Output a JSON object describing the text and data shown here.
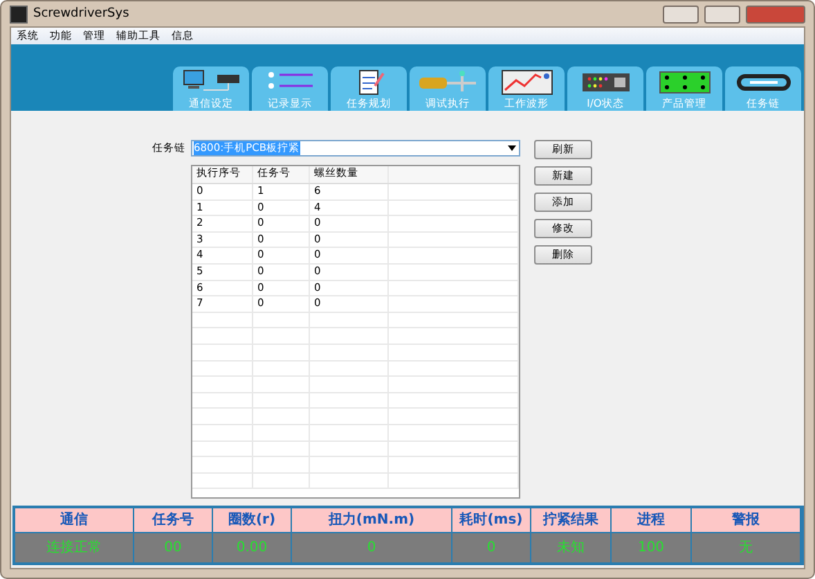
{
  "window": {
    "title": "ScrewdriverSys"
  },
  "menu": [
    "系统",
    "功能",
    "管理",
    "辅助工具",
    "信息"
  ],
  "tabs": [
    {
      "label": "通信设定",
      "kind": "monitor",
      "selected": false
    },
    {
      "label": "记录显示",
      "kind": "list",
      "selected": false
    },
    {
      "label": "任务规划",
      "kind": "document",
      "selected": false
    },
    {
      "label": "调试执行",
      "kind": "screwdriver",
      "selected": false
    },
    {
      "label": "工作波形",
      "kind": "chart",
      "selected": false
    },
    {
      "label": "I/O状态",
      "kind": "panel",
      "selected": false
    },
    {
      "label": "产品管理",
      "kind": "board",
      "selected": false
    },
    {
      "label": "任务链",
      "kind": "chain",
      "selected": false
    }
  ],
  "task_chain": {
    "label": "任务链",
    "value": "6800:手机PCB板拧紧"
  },
  "table": {
    "columns": [
      "执行序号",
      "任务号",
      "螺丝数量"
    ],
    "rows": [
      [
        "0",
        "1",
        "6"
      ],
      [
        "1",
        "0",
        "4"
      ],
      [
        "2",
        "0",
        "0"
      ],
      [
        "3",
        "0",
        "0"
      ],
      [
        "4",
        "0",
        "0"
      ],
      [
        "5",
        "0",
        "0"
      ],
      [
        "6",
        "0",
        "0"
      ],
      [
        "7",
        "0",
        "0"
      ]
    ]
  },
  "buttons": [
    "刷新",
    "新建",
    "添加",
    "修改",
    "删除"
  ],
  "status": {
    "headers": [
      "通信",
      "任务号",
      "圈数(r)",
      "扭力(mN.m)",
      "耗时(ms)",
      "拧紧结果",
      "进程",
      "警报"
    ],
    "values": [
      "连接正常",
      "00",
      "0.00",
      "0",
      "0",
      "未知",
      "100",
      "无"
    ]
  }
}
